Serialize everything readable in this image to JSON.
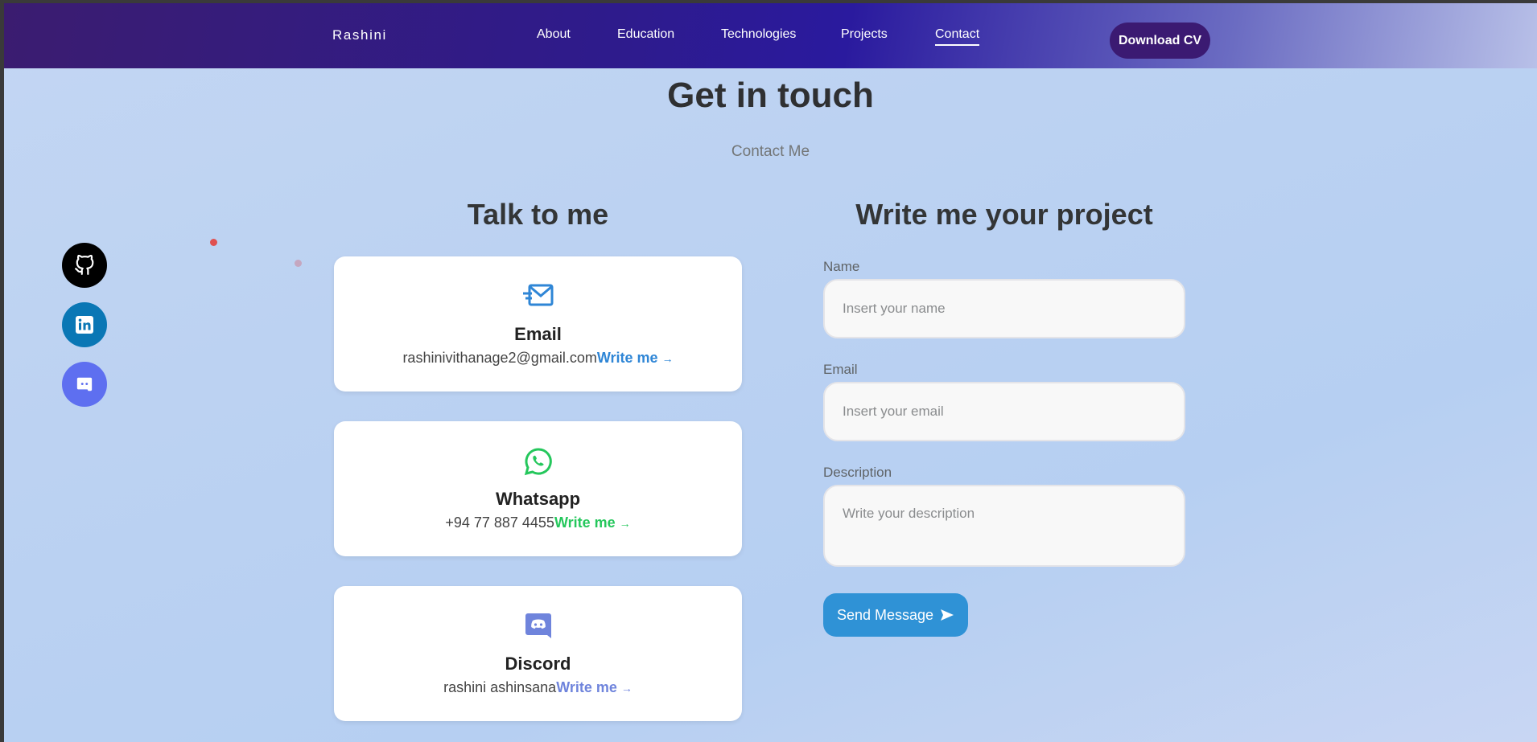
{
  "header": {
    "brand": "Rashini",
    "nav": [
      {
        "label": "About"
      },
      {
        "label": "Education"
      },
      {
        "label": "Technologies"
      },
      {
        "label": "Projects"
      },
      {
        "label": "Contact",
        "active": true
      }
    ],
    "cv_button": "Download CV"
  },
  "contact": {
    "title": "Get in touch",
    "subtitle": "Contact Me",
    "talk_title": "Talk to me",
    "write_title": "Write me your project"
  },
  "social": [
    {
      "icon": "github-icon",
      "color": "#000000"
    },
    {
      "icon": "linkedin-icon",
      "color": "#0a77b5"
    },
    {
      "icon": "discord-icon",
      "color": "#5e6ff0"
    }
  ],
  "cards": [
    {
      "icon": "mail-icon",
      "title": "Email",
      "value": "rashinivithanage2@gmail.com",
      "link": "Write me",
      "arrow": "→",
      "accent": "#2f86d6"
    },
    {
      "icon": "whatsapp-icon",
      "title": "Whatsapp",
      "value": "+94 77 887 4455",
      "link": "Write me",
      "arrow": "→",
      "accent": "#25c75c"
    },
    {
      "icon": "discord-icon",
      "title": "Discord",
      "value": "rashini ashinsana",
      "link": "Write me",
      "arrow": "→",
      "accent": "#6f84dc"
    }
  ],
  "form": {
    "name_label": "Name",
    "name_placeholder": "Insert your name",
    "email_label": "Email",
    "email_placeholder": "Insert your email",
    "description_label": "Description",
    "description_placeholder": "Write your description",
    "send_label": "Send Message"
  }
}
